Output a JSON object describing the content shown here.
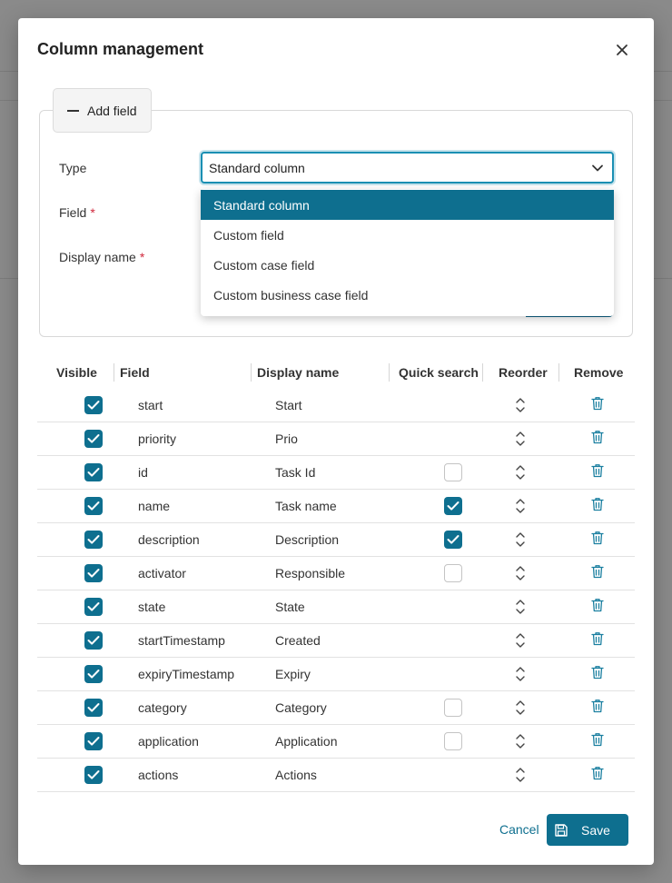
{
  "dialog": {
    "title": "Column management",
    "close_icon": "close-icon"
  },
  "add_field": {
    "label": "Add field",
    "icon": "minus-icon"
  },
  "form": {
    "type_label": "Type",
    "field_label": "Field",
    "display_name_label": "Display name",
    "required_marker": "*",
    "type_value": "Standard column",
    "type_options": [
      "Standard column",
      "Custom field",
      "Custom case field",
      "Custom business case field"
    ]
  },
  "table": {
    "headers": {
      "visible": "Visible",
      "field": "Field",
      "display_name": "Display name",
      "quick_search": "Quick search",
      "reorder": "Reorder",
      "remove": "Remove"
    },
    "rows": [
      {
        "visible": true,
        "field": "start",
        "display_name": "Start",
        "quick_search": null
      },
      {
        "visible": true,
        "field": "priority",
        "display_name": "Prio",
        "quick_search": null
      },
      {
        "visible": true,
        "field": "id",
        "display_name": "Task Id",
        "quick_search": false
      },
      {
        "visible": true,
        "field": "name",
        "display_name": "Task name",
        "quick_search": true
      },
      {
        "visible": true,
        "field": "description",
        "display_name": "Description",
        "quick_search": true
      },
      {
        "visible": true,
        "field": "activator",
        "display_name": "Responsible",
        "quick_search": false
      },
      {
        "visible": true,
        "field": "state",
        "display_name": "State",
        "quick_search": null
      },
      {
        "visible": true,
        "field": "startTimestamp",
        "display_name": "Created",
        "quick_search": null
      },
      {
        "visible": true,
        "field": "expiryTimestamp",
        "display_name": "Expiry",
        "quick_search": null
      },
      {
        "visible": true,
        "field": "category",
        "display_name": "Category",
        "quick_search": false
      },
      {
        "visible": true,
        "field": "application",
        "display_name": "Application",
        "quick_search": false
      },
      {
        "visible": true,
        "field": "actions",
        "display_name": "Actions",
        "quick_search": null
      }
    ]
  },
  "footer": {
    "cancel_label": "Cancel",
    "save_label": "Save",
    "save_icon": "floppy-disk-icon"
  },
  "colors": {
    "accent": "#0e6f8f",
    "focus_ring": "#1a8fb3",
    "required": "#d0283c"
  }
}
